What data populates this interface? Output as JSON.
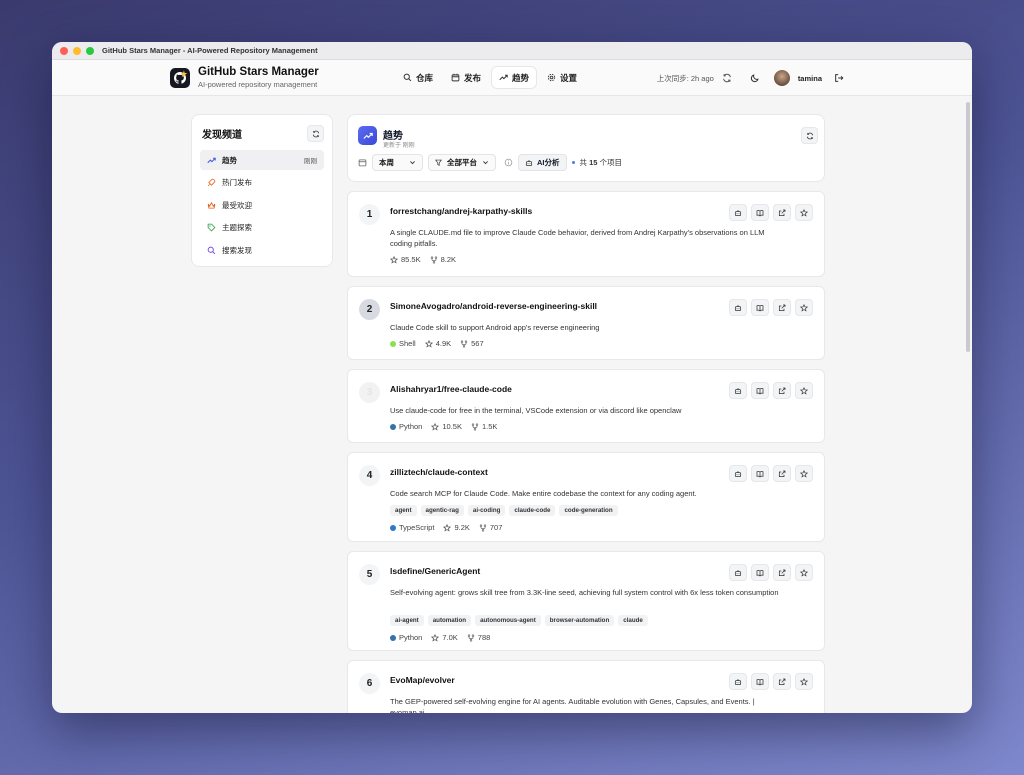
{
  "window": {
    "title": "GitHub Stars Manager - AI-Powered Repository Management"
  },
  "brand": {
    "name": "GitHub Stars Manager",
    "subtitle": "AI-powered repository management"
  },
  "nav": [
    {
      "label": "仓库",
      "icon": "search-icon"
    },
    {
      "label": "发布",
      "icon": "calendar-icon"
    },
    {
      "label": "趋势",
      "icon": "trending-icon",
      "active": true
    },
    {
      "label": "设置",
      "icon": "gear-icon"
    }
  ],
  "header": {
    "sync": "上次同步: 2h ago",
    "username": "tamina"
  },
  "sidebar": {
    "title": "发现频道",
    "items": [
      {
        "label": "趋势",
        "badge": "刚刚",
        "icon": "trending-icon",
        "color": "#3b5bdb"
      },
      {
        "label": "热门发布",
        "icon": "rocket-icon",
        "color": "#e8590c"
      },
      {
        "label": "最受欢迎",
        "icon": "crown-icon",
        "color": "#e8590c"
      },
      {
        "label": "主题探索",
        "icon": "tag-icon",
        "color": "#2f9e44"
      },
      {
        "label": "搜索发现",
        "icon": "search-icon",
        "color": "#7048e8"
      }
    ]
  },
  "main": {
    "title": "趋势",
    "updated": "更新于 刚刚",
    "period": "本周",
    "platform": "全部平台",
    "ai_label": "AI分析",
    "count_prefix": "共",
    "count": "15",
    "count_suffix": "个项目"
  },
  "repos": [
    {
      "rank": "1",
      "name": "forrestchang/andrej-karpathy-skills",
      "desc": "A single CLAUDE.md file to improve Claude Code behavior, derived from Andrej Karpathy's observations on LLM coding pitfalls.",
      "stars": "85.5K",
      "forks": "8.2K"
    },
    {
      "rank": "2",
      "name": "SimoneAvogadro/android-reverse-engineering-skill",
      "desc": "Claude Code skill to support Android app's reverse engineering",
      "language": "Shell",
      "lang_color": "#89e051",
      "stars": "4.9K",
      "forks": "567"
    },
    {
      "rank": "3",
      "name": "Alishahryar1/free-claude-code",
      "desc": "Use claude-code for free in the terminal, VSCode extension or via discord like openclaw",
      "language": "Python",
      "lang_color": "#3572A5",
      "stars": "10.5K",
      "forks": "1.5K"
    },
    {
      "rank": "4",
      "name": "zilliztech/claude-context",
      "desc": "Code search MCP for Claude Code. Make entire codebase the context for any coding agent.",
      "tags": [
        "agent",
        "agentic-rag",
        "ai-coding",
        "claude-code",
        "code-generation"
      ],
      "language": "TypeScript",
      "lang_color": "#3178c6",
      "stars": "9.2K",
      "forks": "707"
    },
    {
      "rank": "5",
      "name": "lsdefine/GenericAgent",
      "desc": "Self-evolving agent: grows skill tree from 3.3K-line seed, achieving full system control with 6x less token consumption",
      "tags": [
        "ai-agent",
        "automation",
        "autonomous-agent",
        "browser-automation",
        "claude"
      ],
      "language": "Python",
      "lang_color": "#3572A5",
      "stars": "7.0K",
      "forks": "788"
    },
    {
      "rank": "6",
      "name": "EvoMap/evolver",
      "desc": "The GEP-powered self-evolving engine for AI agents. Auditable evolution with Genes, Capsules, and Events. | evomap.ai"
    }
  ]
}
